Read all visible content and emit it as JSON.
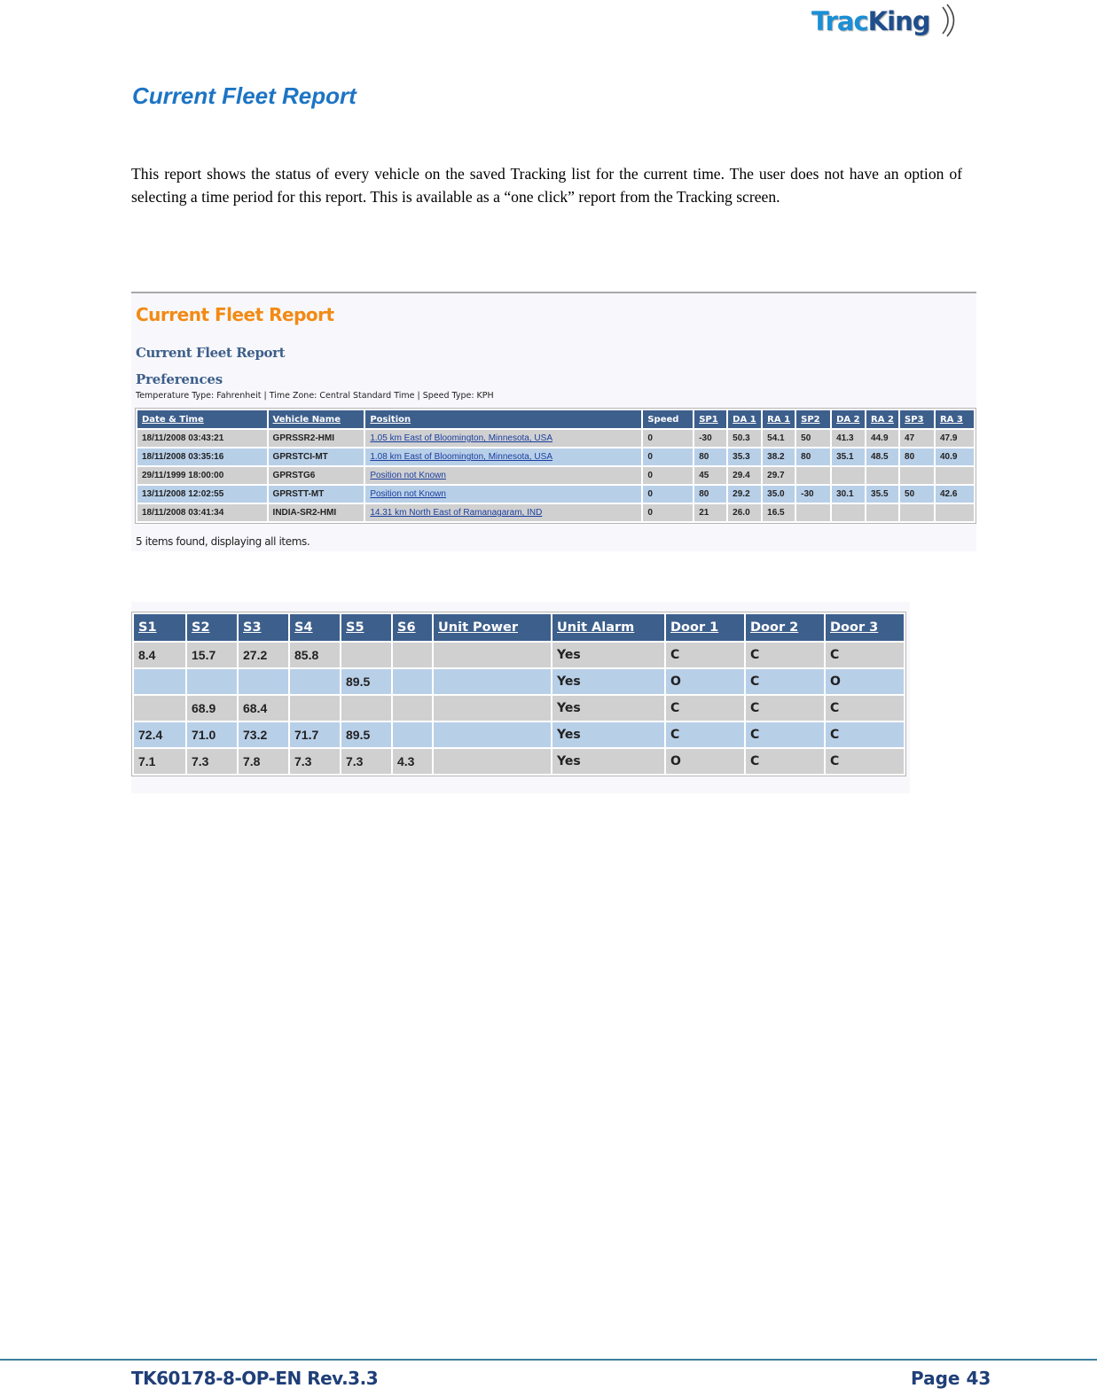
{
  "logo": {
    "part1": "Trac",
    "part2": "King"
  },
  "document": {
    "title": "Current Fleet Report",
    "intro": "This report shows the status of every vehicle on the saved Tracking list for the current time. The user does not have an option of selecting a time period for this report. This is available as a “one click” report from the Tracking screen."
  },
  "screenshot1": {
    "app_title": "Current Fleet Report",
    "sub_title": "Current Fleet Report",
    "preferences_title": "Preferences",
    "preferences_line": "Temperature Type: Fahrenheit | Time Zone: Central Standard Time | Speed Type: KPH",
    "columns": [
      "Date & Time",
      "Vehicle Name",
      "Position",
      "Speed",
      "SP1",
      "DA 1",
      "RA 1",
      "SP2",
      "DA 2",
      "RA 2",
      "SP3",
      "RA 3"
    ],
    "rows": [
      [
        "18/11/2008 03:43:21",
        "GPRSSR2-HMI",
        "1.05 km East of Bloomington, Minnesota, USA",
        "0",
        "-30",
        "50.3",
        "54.1",
        "50",
        "41.3",
        "44.9",
        "47",
        "47.9"
      ],
      [
        "18/11/2008 03:35:16",
        "GPRSTCI-MT",
        "1.08 km East of Bloomington, Minnesota, USA",
        "0",
        "80",
        "35.3",
        "38.2",
        "80",
        "35.1",
        "48.5",
        "80",
        "40.9"
      ],
      [
        "29/11/1999 18:00:00",
        "GPRSTG6",
        "Position not Known",
        "0",
        "45",
        "29.4",
        "29.7",
        "",
        "",
        "",
        "",
        ""
      ],
      [
        "13/11/2008 12:02:55",
        "GPRSTT-MT",
        "Position not Known",
        "0",
        "80",
        "29.2",
        "35.0",
        "-30",
        "30.1",
        "35.5",
        "50",
        "42.6"
      ],
      [
        "18/11/2008 03:41:34",
        "INDIA-SR2-HMI",
        "14.31 km North East of Ramanagaram, IND",
        "0",
        "21",
        "26.0",
        "16.5",
        "",
        "",
        "",
        "",
        ""
      ]
    ],
    "items_found": "5 items found, displaying all items."
  },
  "screenshot2": {
    "columns": [
      "S1",
      "S2",
      "S3",
      "S4",
      "S5",
      "S6",
      "Unit Power",
      "Unit Alarm",
      "Door 1",
      "Door 2",
      "Door 3"
    ],
    "rows": [
      [
        "8.4",
        "15.7",
        "27.2",
        "85.8",
        "",
        "",
        "",
        "Yes",
        "C",
        "C",
        "C"
      ],
      [
        "",
        "",
        "",
        "",
        "89.5",
        "",
        "",
        "Yes",
        "O",
        "C",
        "O"
      ],
      [
        "",
        "68.9",
        "68.4",
        "",
        "",
        "",
        "",
        "Yes",
        "C",
        "C",
        "C"
      ],
      [
        "72.4",
        "71.0",
        "73.2",
        "71.7",
        "89.5",
        "",
        "",
        "Yes",
        "C",
        "C",
        "C"
      ],
      [
        "7.1",
        "7.3",
        "7.8",
        "7.3",
        "7.3",
        "4.3",
        "",
        "Yes",
        "O",
        "C",
        "C"
      ]
    ]
  },
  "footer": {
    "doc_id": "TK60178-8-OP-EN Rev.3.3",
    "page_label": "Page  43"
  }
}
